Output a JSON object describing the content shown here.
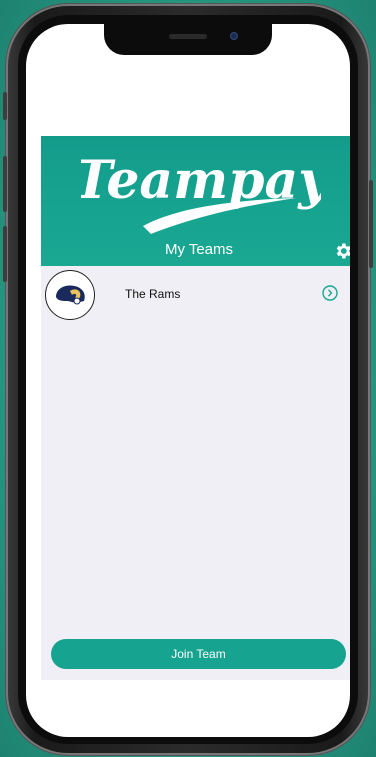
{
  "app": {
    "logo_text": "Teampay",
    "header_title": "My Teams",
    "icons": {
      "settings": "gear-icon",
      "chevron": "chevron-right-circle-icon",
      "team_logo": "rams-helmet-logo"
    },
    "colors": {
      "brand": "#17a591",
      "background": "#efeff5"
    }
  },
  "teams": [
    {
      "name": "The Rams"
    }
  ],
  "footer": {
    "join_label": "Join Team"
  }
}
